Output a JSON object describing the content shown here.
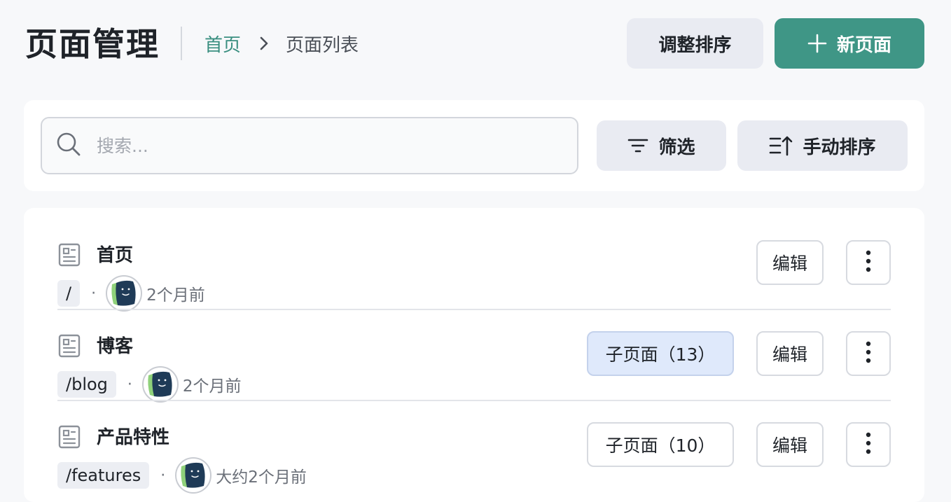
{
  "header": {
    "title": "页面管理",
    "breadcrumb": {
      "home": "首页",
      "current": "页面列表"
    },
    "sort_button": "调整排序",
    "new_button": "新页面"
  },
  "toolbar": {
    "search_placeholder": "搜索...",
    "filter_label": "筛选",
    "manual_sort_label": "手动排序"
  },
  "pages": [
    {
      "title": "首页",
      "path": "/",
      "time": "2个月前",
      "children_label": "",
      "edit_label": "编辑"
    },
    {
      "title": "博客",
      "path": "/blog",
      "time": "2个月前",
      "children_label": "子页面（13）",
      "edit_label": "编辑"
    },
    {
      "title": "产品特性",
      "path": "/features",
      "time": "大约2个月前",
      "children_label": "子页面（10）",
      "edit_label": "编辑"
    }
  ],
  "colors": {
    "accent": "#3f9686",
    "link": "#3a8f80",
    "avatar_bg": "#1f3b57",
    "avatar_accent": "#8fd17a"
  }
}
